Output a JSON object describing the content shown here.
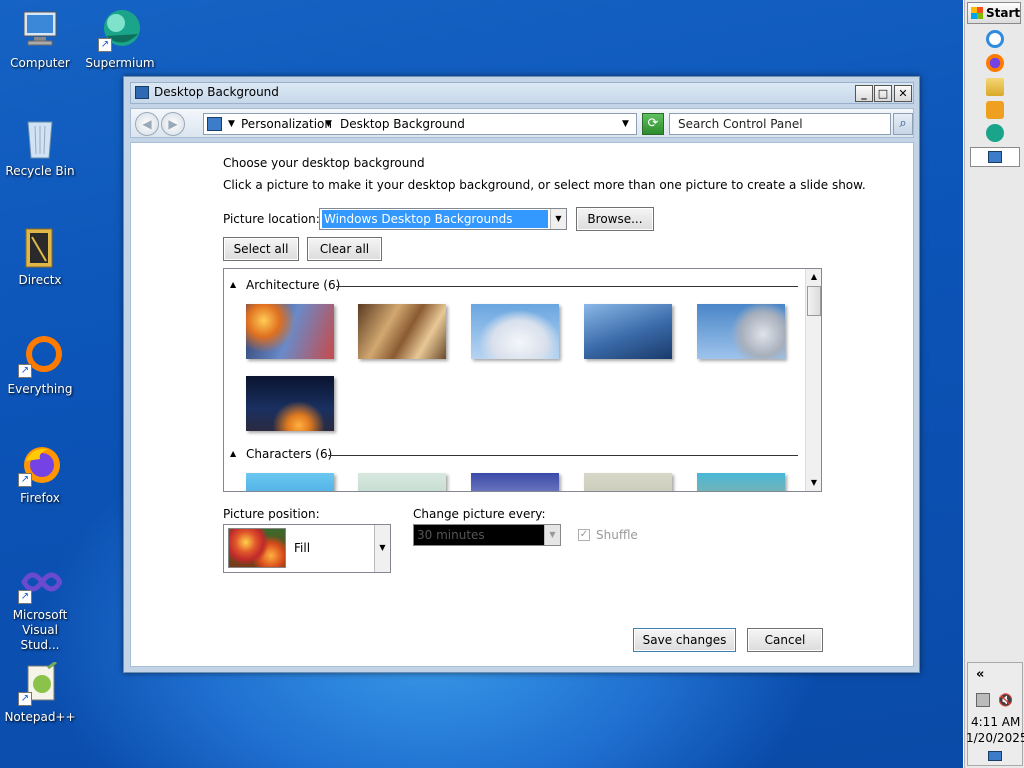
{
  "desktop": {
    "icons": [
      {
        "label": "Computer"
      },
      {
        "label": "Supermium"
      },
      {
        "label": "Recycle Bin"
      },
      {
        "label": "Directx"
      },
      {
        "label": "Everything"
      },
      {
        "label": "Firefox"
      },
      {
        "label": "Microsoft Visual Stud..."
      },
      {
        "label": "Notepad++"
      }
    ]
  },
  "taskbar": {
    "start_label": "Start",
    "tray_chevron": "«",
    "time": "4:11 AM",
    "date": "1/20/2025"
  },
  "window": {
    "title": "Desktop Background",
    "controls": {
      "minimize": "_",
      "maximize": "□",
      "close": "✕"
    },
    "address": {
      "crumbs": [
        "Personalization",
        "Desktop Background"
      ],
      "separator": "▶"
    },
    "search_placeholder": "Search Control Panel",
    "heading": "Choose your desktop background",
    "instructions": "Click a picture to make it your desktop background, or select more than one picture to create a slide show.",
    "picture_location_label": "Picture location:",
    "picture_location_value": "Windows Desktop Backgrounds",
    "browse_label": "Browse...",
    "select_all_label": "Select all",
    "clear_all_label": "Clear all",
    "groups": [
      {
        "title": "Architecture (6)"
      },
      {
        "title": "Characters (6)"
      }
    ],
    "picture_position_label": "Picture position:",
    "picture_position_value": "Fill",
    "change_picture_label": "Change picture every:",
    "change_picture_value": "30 minutes",
    "shuffle_label": "Shuffle",
    "save_label": "Save changes",
    "cancel_label": "Cancel"
  }
}
